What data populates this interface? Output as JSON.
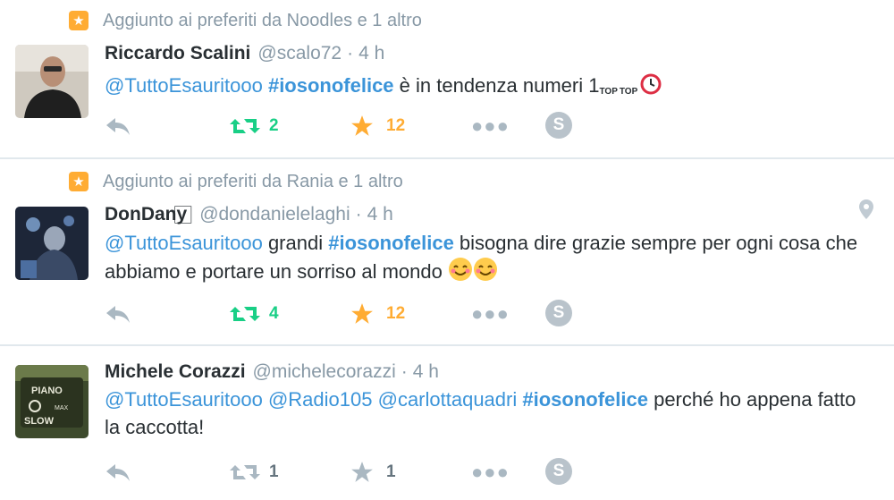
{
  "tweets": [
    {
      "context": "Aggiunto ai preferiti da Noodles e 1 altro",
      "name": "Riccardo Scalini",
      "handle": "@scalo72",
      "time": "4 h",
      "text": {
        "m1": "@TuttoEsauritooo",
        "h1": "#iosonofelice",
        "t1": " è in tendenza numeri 1",
        "top1": "TOP",
        "top2": "TOP"
      },
      "retweets": "2",
      "favorites": "12"
    },
    {
      "context": "Aggiunto ai preferiti da Rania e 1 altro",
      "name": "DonDany",
      "name_glyph": "⃞",
      "handle": "@dondanielelaghi",
      "time": "4 h",
      "text": {
        "m1": "@TuttoEsauritooo",
        "t1": " grandi ",
        "h1": "#iosonofelice",
        "t2": " bisogna dire grazie sempre per ogni cosa che abbiamo e portare un sorriso al mondo "
      },
      "retweets": "4",
      "favorites": "12"
    },
    {
      "name": "Michele Corazzi",
      "handle": "@michelecorazzi",
      "time": "4 h",
      "text": {
        "m1": "@TuttoEsauritooo",
        "m2": "@Radio105",
        "m3": "@carlottaquadri",
        "h1": "#iosonofelice",
        "t1": " perché ho appena fatto la caccotta!"
      },
      "retweets": "1",
      "favorites": "1"
    }
  ],
  "icons": {
    "favorite_badge": "star-icon",
    "reply": "reply-icon",
    "retweet": "retweet-icon",
    "favorite": "star-icon",
    "more": "more-dots-icon",
    "s_button": "S",
    "location": "location-pin-icon"
  },
  "colors": {
    "link": "#3b94d9",
    "retweet_active": "#19cf86",
    "favorite_active": "#ffac33",
    "muted": "#8899a6"
  }
}
